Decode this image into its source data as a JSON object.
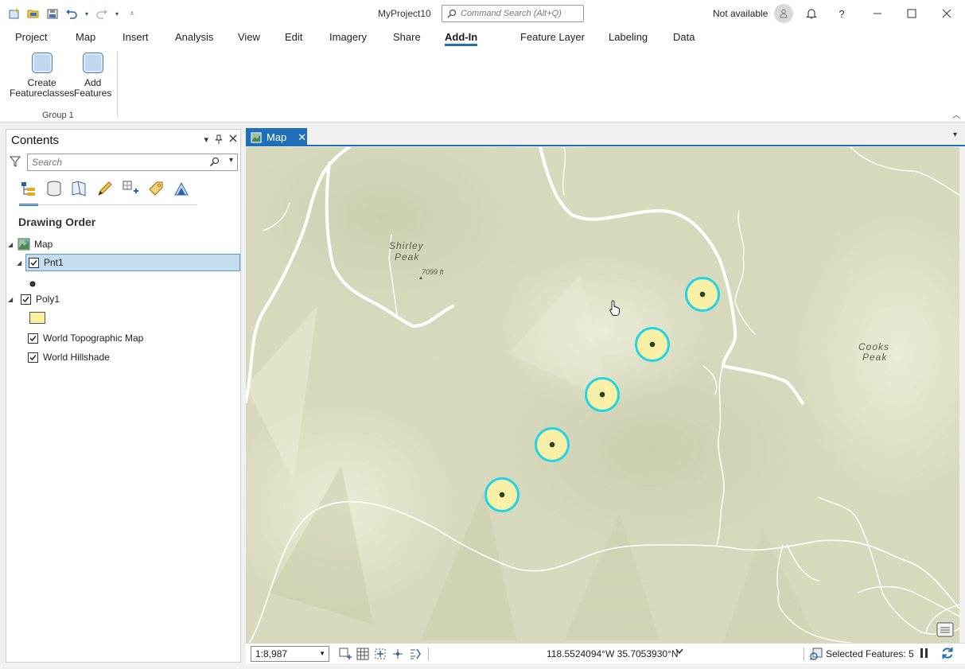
{
  "window": {
    "project_title": "MyProject10",
    "command_search_placeholder": "Command Search (Alt+Q)",
    "account_status": "Not available",
    "help": "?"
  },
  "ribbon": {
    "tabs": [
      "Project",
      "Map",
      "Insert",
      "Analysis",
      "View",
      "Edit",
      "Imagery",
      "Share",
      "Add-In"
    ],
    "active_tab": "Add-In",
    "contextual_tabs": [
      "Feature Layer",
      "Labeling",
      "Data"
    ],
    "buttons": [
      {
        "label_line1": "Create",
        "label_line2": "Featureclasses"
      },
      {
        "label_line1": "Add",
        "label_line2": "Features"
      }
    ],
    "group_label": "Group 1"
  },
  "contents": {
    "title": "Contents",
    "search_placeholder": "Search",
    "section": "Drawing Order",
    "layers": {
      "map": "Map",
      "pnt1": "Pnt1",
      "poly1": "Poly1",
      "topo": "World Topographic Map",
      "hillshade": "World Hillshade"
    }
  },
  "map": {
    "tab_label": "Map",
    "labels": {
      "shirley_1": "Shirley",
      "shirley_2": "Peak",
      "elevation": "7099 ft",
      "cooks_1": "Cooks",
      "cooks_2": "Peak"
    },
    "feature_count_drawn": 5
  },
  "status": {
    "scale": "1:8,987",
    "coordinates": "118.5524094°W 35.7053930°N",
    "selected_features": "Selected Features: 5"
  },
  "colors": {
    "accent": "#1e6fb8",
    "selection_ring": "#22d3e6",
    "point_fill": "#f7f0a6",
    "map_bg": "#d9dbc0"
  }
}
